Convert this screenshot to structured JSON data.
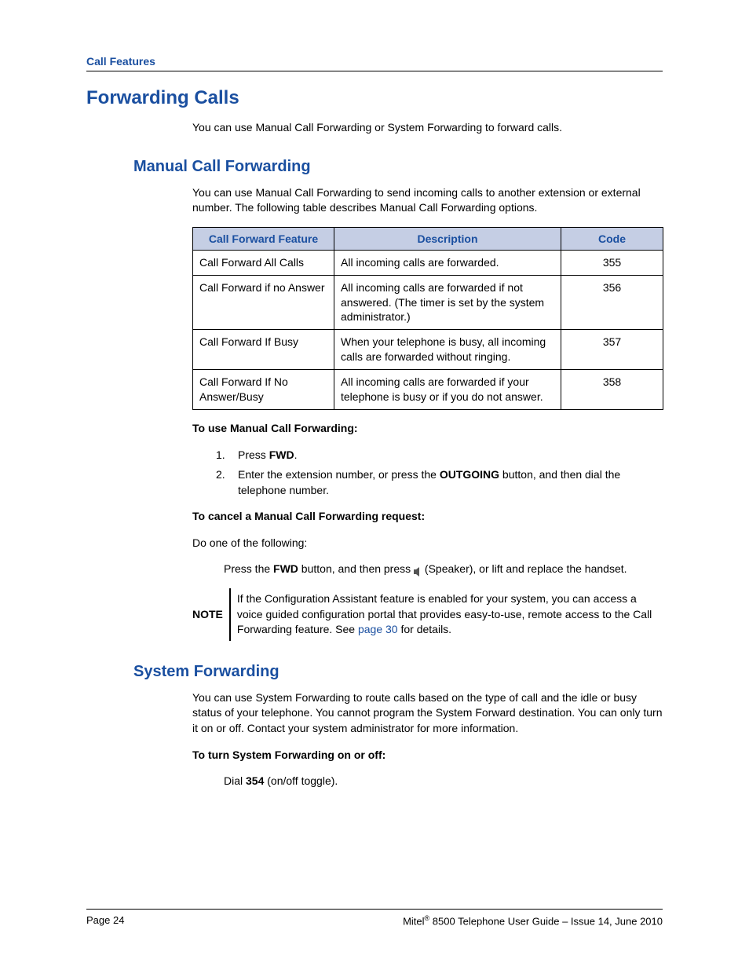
{
  "header": {
    "label": "Call Features"
  },
  "h1": "Forwarding Calls",
  "intro": "You can use Manual Call Forwarding or System Forwarding to forward calls.",
  "manual": {
    "heading": "Manual Call Forwarding",
    "intro": "You can use Manual Call Forwarding to send incoming calls to another extension or external number. The following table describes Manual Call Forwarding options.",
    "table": {
      "headers": {
        "feature": "Call Forward Feature",
        "description": "Description",
        "code": "Code"
      },
      "rows": [
        {
          "feature": "Call Forward All Calls",
          "description": "All incoming calls are forwarded.",
          "code": "355"
        },
        {
          "feature": "Call Forward if no Answer",
          "description": "All incoming calls are forwarded if not answered. (The timer is set by the system administrator.)",
          "code": "356"
        },
        {
          "feature": "Call Forward If Busy",
          "description": "When your telephone is busy, all incoming calls are forwarded without ringing.",
          "code": "357"
        },
        {
          "feature": "Call Forward If No Answer/Busy",
          "description": "All incoming calls are forwarded if your telephone is busy or if you do not answer.",
          "code": "358"
        }
      ]
    },
    "use_heading": "To use Manual Call Forwarding:",
    "steps": {
      "s1_a": "Press ",
      "s1_b": "FWD",
      "s1_c": ".",
      "s2_a": "Enter the extension number, or press the ",
      "s2_b": "OUTGOING",
      "s2_c": " button, and then dial the telephone number."
    },
    "cancel_heading": "To cancel a Manual Call Forwarding request:",
    "cancel_intro": "Do one of the following:",
    "cancel_line_a": "Press the ",
    "cancel_line_b": "FWD",
    "cancel_line_c": " button, and then press ",
    "cancel_line_d": " (Speaker), or lift and replace the handset.",
    "note_label": "NOTE",
    "note_a": "If the Configuration Assistant feature is enabled for your system, you can access a voice guided configuration portal that provides easy-to-use, remote access to the Call Forwarding feature. See ",
    "note_link": "page 30",
    "note_b": " for details."
  },
  "system": {
    "heading": "System Forwarding",
    "intro": "You can use System Forwarding to route calls based on the type of call and the idle or busy status of your telephone. You cannot program the System Forward destination. You can only turn it on or off. Contact your system administrator for more information.",
    "toggle_heading": "To turn System Forwarding on or off:",
    "toggle_a": "Dial ",
    "toggle_b": "354",
    "toggle_c": " (on/off toggle)."
  },
  "footer": {
    "left": "Page 24",
    "right_a": "Mitel",
    "right_sup": "®",
    "right_b": " 8500 Telephone User Guide – Issue 14, June 2010"
  }
}
